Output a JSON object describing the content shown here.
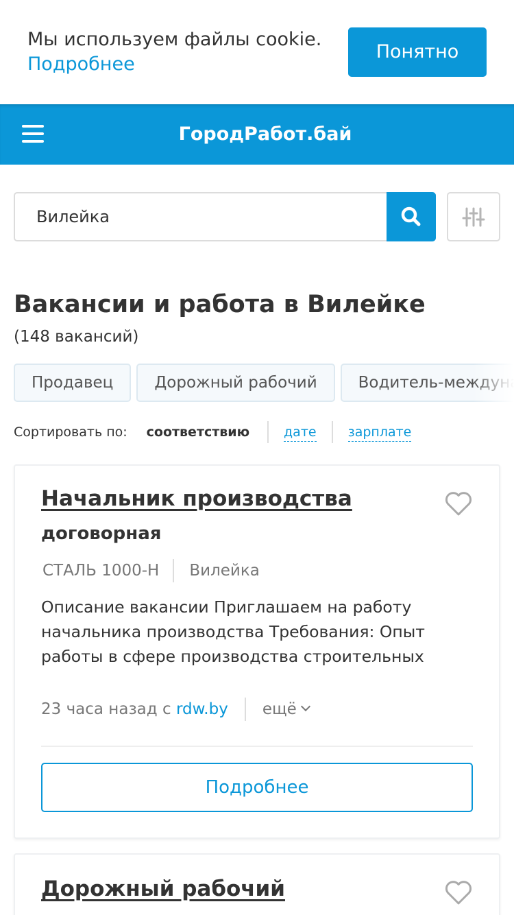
{
  "cookie": {
    "text": "Мы используем файлы cookie.",
    "link": "Подробнее",
    "accept": "Понятно"
  },
  "header": {
    "brand": "ГородРабот.бай"
  },
  "search": {
    "value": "Вилейка"
  },
  "results": {
    "title": "Вакансии и работа в Вилейке",
    "count": "(148 вакансий)"
  },
  "chips": [
    "Продавец",
    "Дорожный рабочий",
    "Водитель-международник"
  ],
  "sort": {
    "label": "Сортировать по:",
    "active": "соответствию",
    "date": "дате",
    "salary": "зарплате"
  },
  "vacancies": [
    {
      "title": "Начальник производства",
      "salary": "договорная",
      "company": "СТАЛЬ 1000-Н",
      "city": "Вилейка",
      "description": "Описание вакансии Приглашаем на работу начальника производства Требования: Опыт работы в сфере производства строительных",
      "ago": "23 часа назад с",
      "source": "rdw.by",
      "more": "ещё",
      "button": "Подробнее"
    },
    {
      "title": "Дорожный рабочий"
    }
  ],
  "colors": {
    "accent": "#0b97d8",
    "text": "#333333",
    "muted": "#777777"
  }
}
